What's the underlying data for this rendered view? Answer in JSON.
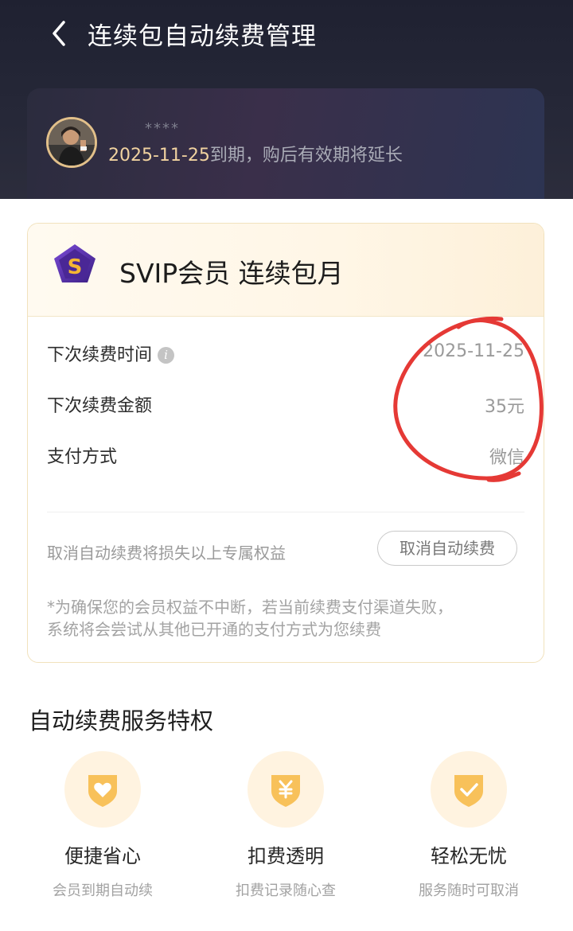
{
  "header": {
    "title": "连续包自动续费管理",
    "back_icon": "back-arrow-icon"
  },
  "user": {
    "masked_name": "****",
    "expire_date": "2025-11-25",
    "expire_suffix": "到期，购后有效期将延长"
  },
  "membership": {
    "title": "SVIP会员 连续包月",
    "icon": "svip-diamond-icon",
    "rows": [
      {
        "label": "下次续费时间",
        "value": "2025-11-25"
      },
      {
        "label": "下次续费金额",
        "value": "35元"
      },
      {
        "label": "支付方式",
        "value": "微信"
      }
    ],
    "info_icon_glyph": "i",
    "lose_notice": "取消自动续费将损失以上专属权益",
    "cancel_label": "取消自动续费",
    "note_line1": "*为确保您的会员权益不中断，若当前续费支付渠道失败，",
    "note_line2": "系统将会尝试从其他已开通的支付方式为您续费"
  },
  "privileges": {
    "title": "自动续费服务特权",
    "items": [
      {
        "title": "便捷省心",
        "subtitle": "会员到期自动续",
        "icon": "heart-shield-icon"
      },
      {
        "title": "扣费透明",
        "subtitle": "扣费记录随心查",
        "icon": "yuan-shield-icon"
      },
      {
        "title": "轻松无忧",
        "subtitle": "服务随时可取消",
        "icon": "check-shield-icon"
      }
    ]
  },
  "colors": {
    "header_bg": "#1f2131",
    "gold": "#f1d3a0",
    "card_border": "#f1e2bd",
    "feature_icon": "#f8c15a",
    "annotation": "#e53935"
  }
}
